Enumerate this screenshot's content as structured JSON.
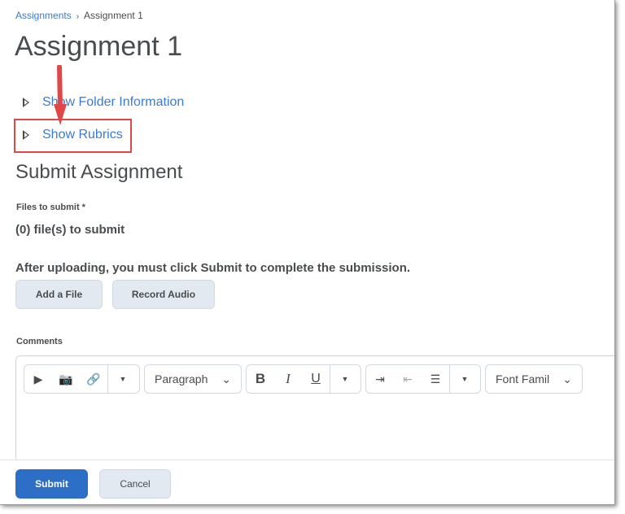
{
  "breadcrumb": {
    "parent": "Assignments",
    "separator": "›",
    "current": "Assignment 1"
  },
  "title": "Assignment 1",
  "toggles": {
    "folder": "Show Folder Information",
    "rubrics": "Show Rubrics"
  },
  "section_title": "Submit Assignment",
  "files": {
    "label": "Files to submit *",
    "count_text": "(0) file(s) to submit",
    "instruction": "After uploading, you must click Submit to complete the submission.",
    "add_file": "Add a File",
    "record_audio": "Record Audio"
  },
  "comments": {
    "label": "Comments",
    "paragraph": "Paragraph",
    "font_family": "Font Famil",
    "bold": "B",
    "italic": "I",
    "underline": "U"
  },
  "footer": {
    "submit": "Submit",
    "cancel": "Cancel"
  },
  "colors": {
    "accent": "#2d6fc7",
    "highlight": "#e04848"
  }
}
